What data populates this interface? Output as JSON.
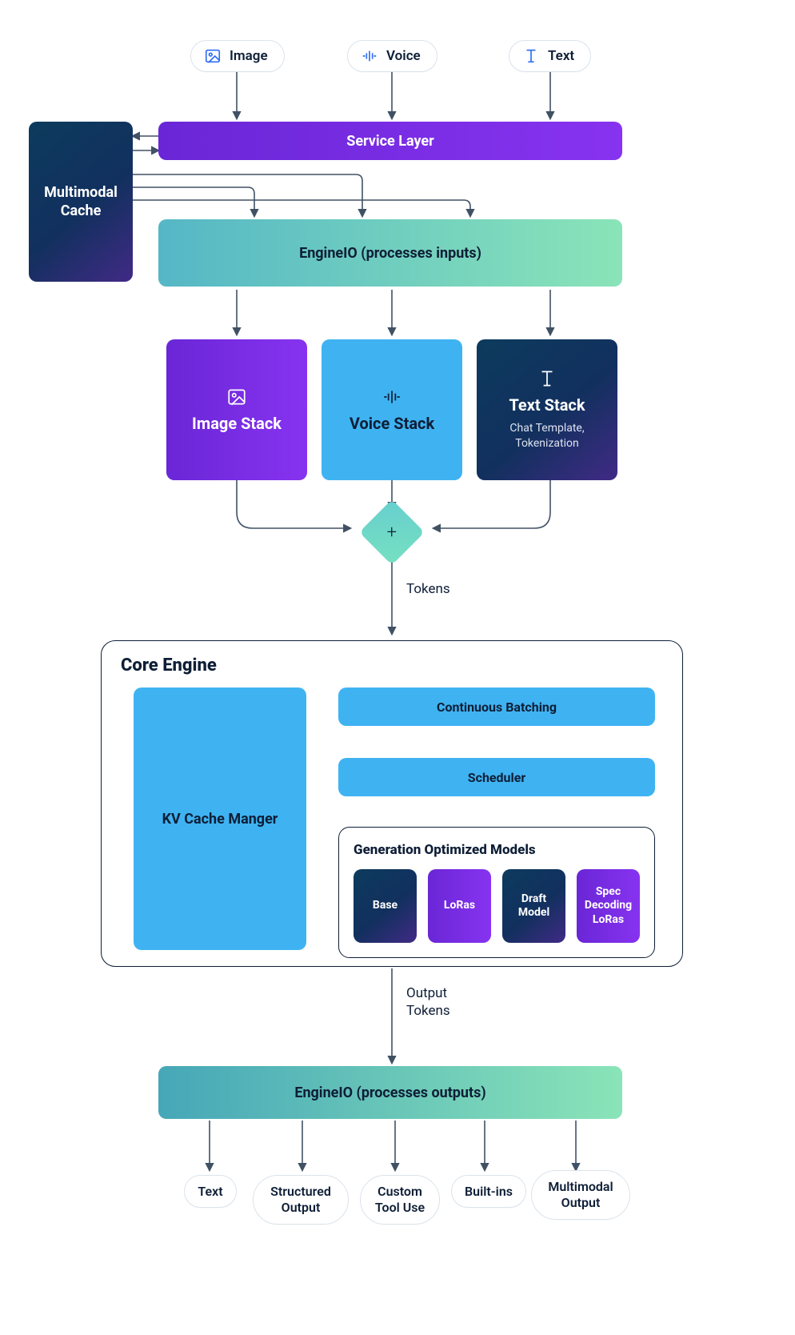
{
  "inputs": {
    "image": "Image",
    "voice": "Voice",
    "text": "Text"
  },
  "service_layer": "Service Layer",
  "multimodal_cache": "Multimodal Cache",
  "engineio_in": "EngineIO (processes inputs)",
  "stacks": {
    "image": "Image Stack",
    "voice": "Voice Stack",
    "text_title": "Text Stack",
    "text_sub": "Chat Template, Tokenization"
  },
  "plus": "+",
  "tokens_label": "Tokens",
  "core_engine": {
    "title": "Core Engine",
    "kv": "KV Cache Manger",
    "batching": "Continuous Batching",
    "scheduler": "Scheduler",
    "gen_title": "Generation Optimized Models",
    "models": {
      "base": "Base",
      "loras": "LoRas",
      "draft": "Draft Model",
      "spec": "Spec Decoding LoRas"
    }
  },
  "output_tokens_label": "Output Tokens",
  "engineio_out": "EngineIO (processes outputs)",
  "outputs": {
    "text": "Text",
    "structured": "Structured Output",
    "custom": "Custom Tool Use",
    "builtins": "Built-ins",
    "multimodal": "Multimodal Output"
  }
}
